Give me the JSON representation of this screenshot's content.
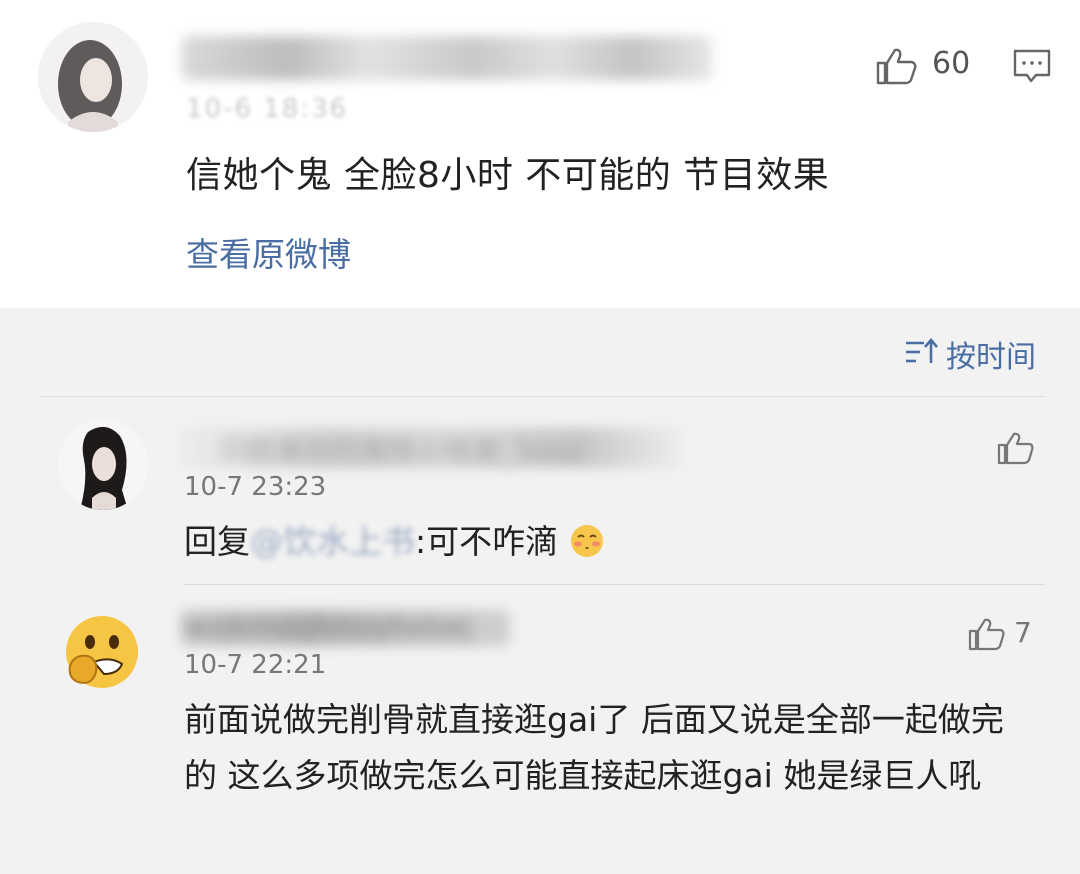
{
  "main_comment": {
    "user_name": "",
    "time": "10-6 18:36",
    "like_count": "60",
    "text": "信她个鬼 全脸8小时 不可能的 节目效果",
    "view_original": "查看原微博"
  },
  "sort": {
    "label": "按时间"
  },
  "replies": [
    {
      "user_name": "只欧美控的撸铁小怪兽_Takei",
      "time": "10-7 23:23",
      "reply_prefix": "回复",
      "mention": "@饮水上书",
      "text": ":可不咋滴",
      "emoji": "emoji-blush-kiss-icon"
    },
    {
      "user_name": "wzjkmskjhmzyhxlsej",
      "time": "10-7 22:21",
      "like_count": "7",
      "text": "前面说做完削骨就直接逛gai了 后面又说是全部一起做完的 这么多项做完怎么可能直接起床逛gai 她是绿巨人吼"
    }
  ],
  "colors": {
    "link_blue": "#4a6ea3",
    "background": "#f2f2f2",
    "card": "#ffffff"
  }
}
